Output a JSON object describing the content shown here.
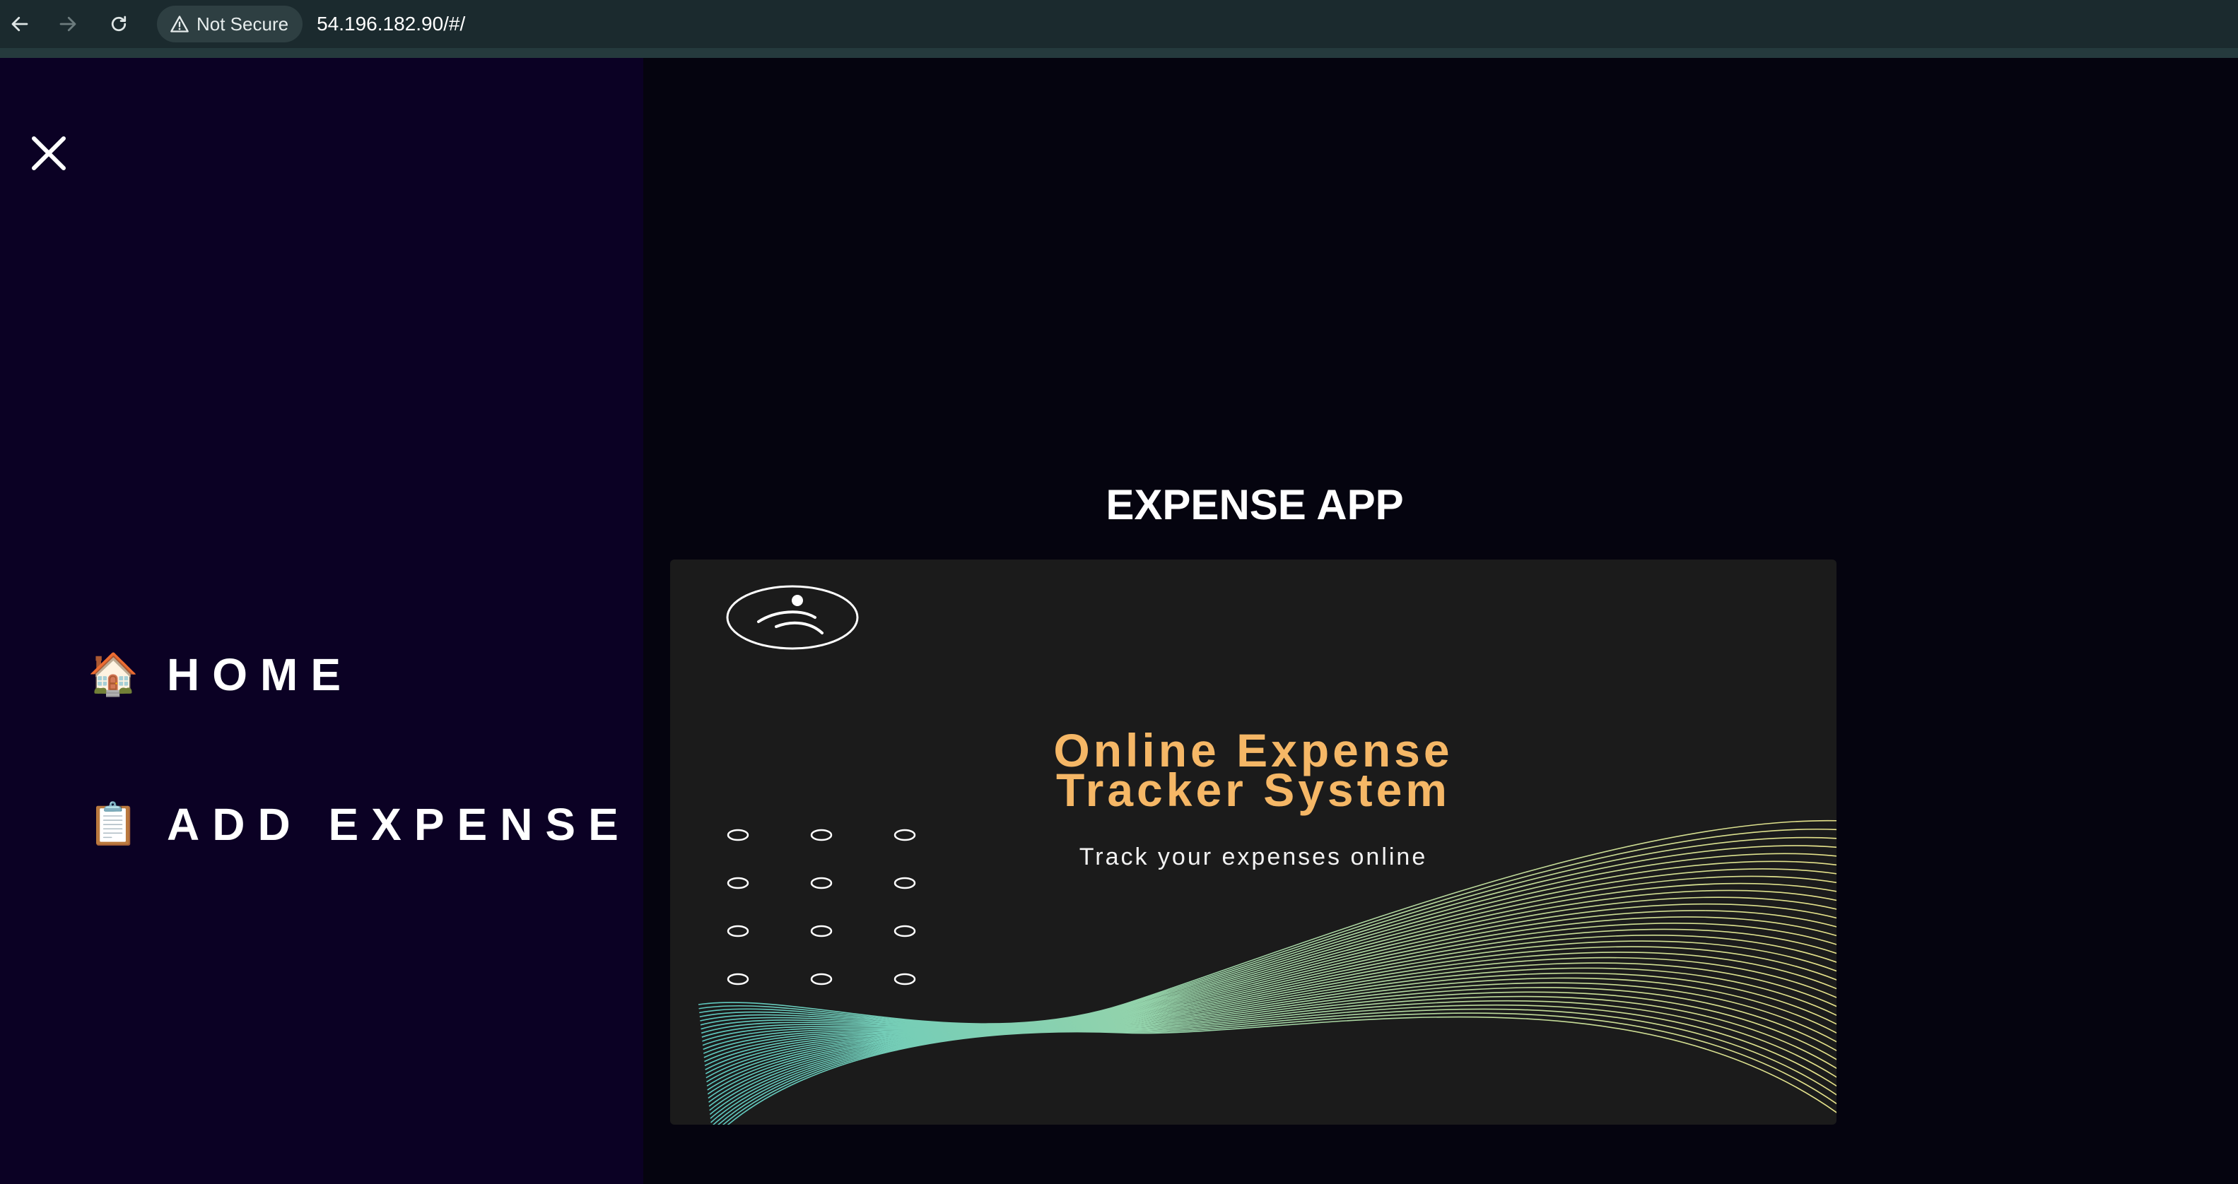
{
  "browser": {
    "security_label": "Not Secure",
    "url": "54.196.182.90/#/"
  },
  "sidebar": {
    "close_icon": "close-icon",
    "items": [
      {
        "icon": "🏠",
        "label": "HOME"
      },
      {
        "icon": "📋",
        "label": "ADD EXPENSE"
      }
    ]
  },
  "main": {
    "title": "EXPENSE APP",
    "banner": {
      "line1": "Online Expense",
      "line2": "Tracker System",
      "subtitle": "Track your expenses online"
    }
  },
  "colors": {
    "sidebar_bg": "#0b0124",
    "main_bg": "#05040f",
    "banner_bg": "#1b1b1b",
    "banner_title": "#f5b766",
    "wave_start": "#5ec9c0",
    "wave_end": "#e8e38a"
  }
}
